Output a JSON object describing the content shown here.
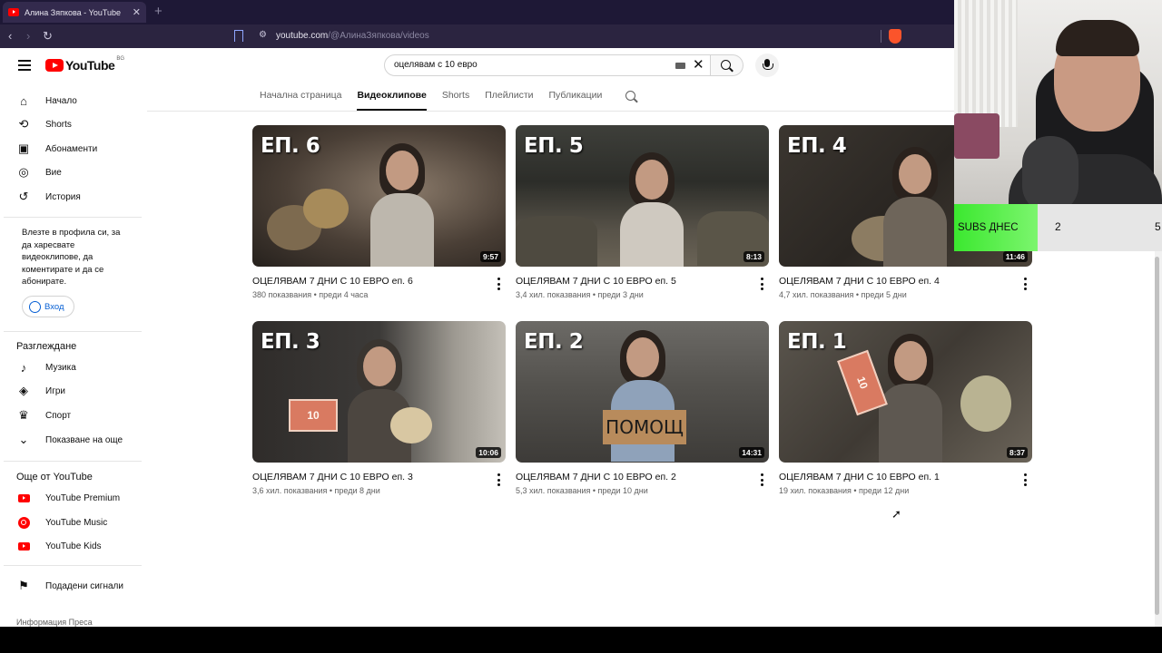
{
  "browser": {
    "tab_title": "Алина Зяпкова - YouTube",
    "tab_close": "✕",
    "new_tab": "+",
    "url_host": "youtube.com",
    "url_path": "/@АлинаЗяпкова/videos"
  },
  "masthead": {
    "logo_text": "YouTube",
    "country": "BG",
    "search_value": "оцелявам с 10 евро",
    "clear": "✕"
  },
  "sidebar": {
    "primary": [
      {
        "label": "Начало",
        "icon": "home-icon"
      },
      {
        "label": "Shorts",
        "icon": "shorts-icon"
      },
      {
        "label": "Абонаменти",
        "icon": "subscriptions-icon"
      },
      {
        "label": "Вие",
        "icon": "you-icon"
      },
      {
        "label": "История",
        "icon": "history-icon"
      }
    ],
    "signin_text": "Влезте в профила си, за да харесвате видеоклипове, да коментирате и да се абонирате.",
    "signin_button": "Вход",
    "explore_heading": "Разглеждане",
    "explore": [
      {
        "label": "Музика",
        "icon": "music-icon"
      },
      {
        "label": "Игри",
        "icon": "gaming-icon"
      },
      {
        "label": "Спорт",
        "icon": "trophy-icon"
      },
      {
        "label": "Показване на още",
        "icon": "chevron-down-icon"
      }
    ],
    "more_heading": "Още от YouTube",
    "more": [
      {
        "label": "YouTube Premium",
        "icon": "youtube-premium-icon"
      },
      {
        "label": "YouTube Music",
        "icon": "youtube-music-icon"
      },
      {
        "label": "YouTube Kids",
        "icon": "youtube-kids-icon"
      }
    ],
    "report": "Подадени сигнали",
    "footer": "Информация   Преса"
  },
  "channel_tabs": [
    "Начална страница",
    "Видеоклипове",
    "Shorts",
    "Плейлисти",
    "Публикации"
  ],
  "active_tab": "Видеоклипове",
  "videos": [
    {
      "ep": "ЕП. 6",
      "duration": "9:57",
      "title": "ОЦЕЛЯВАМ 7 ДНИ С 10 ЕВРО еп. 6",
      "meta": "380 показвания • преди 4 часа"
    },
    {
      "ep": "ЕП. 5",
      "duration": "8:13",
      "title": "ОЦЕЛЯВАМ 7 ДНИ С 10 ЕВРО еп. 5",
      "meta": "3,4 хил. показвания • преди 3 дни"
    },
    {
      "ep": "ЕП. 4",
      "duration": "11:46",
      "title": "ОЦЕЛЯВАМ 7 ДНИ С 10 ЕВРО еп. 4",
      "meta": "4,7 хил. показвания • преди 5 дни"
    },
    {
      "ep": "ЕП. 3",
      "duration": "10:06",
      "title": "ОЦЕЛЯВАМ 7 ДНИ С 10 ЕВРО еп. 3",
      "meta": "3,6 хил. показвания • преди 8 дни",
      "bill": "10"
    },
    {
      "ep": "ЕП. 2",
      "duration": "14:31",
      "title": "ОЦЕЛЯВАМ 7 ДНИ С 10 ЕВРО еп. 2",
      "meta": "5,3 хил. показвания • преди 10 дни",
      "sign": "ПОМОЩ"
    },
    {
      "ep": "ЕП. 1",
      "duration": "8:37",
      "title": "ОЦЕЛЯВАМ 7 ДНИ С 10 ЕВРО еп. 1",
      "meta": "19 хил. показвания • преди 12 дни",
      "bill": "10"
    }
  ],
  "overlay": {
    "subs_label": "SUBS ДНЕС",
    "subs_value": "2",
    "subs_value2": "5"
  }
}
